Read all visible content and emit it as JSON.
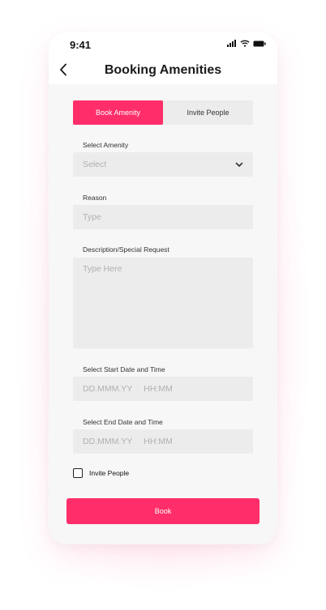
{
  "status_bar": {
    "time": "9:41"
  },
  "header": {
    "title": "Booking Amenities"
  },
  "tabs": [
    {
      "label": "Book Amenity",
      "active": true
    },
    {
      "label": "Invite People",
      "active": false
    }
  ],
  "form": {
    "amenity": {
      "label": "Select Amenity",
      "value": "Select"
    },
    "reason": {
      "label": "Reason",
      "placeholder": "Type"
    },
    "description": {
      "label": "Description/Special Request",
      "placeholder": "Type Here"
    },
    "start": {
      "label": "Select Start Date and Time",
      "date_placeholder": "DD.MMM.YY",
      "time_placeholder": "HH:MM"
    },
    "end": {
      "label": "Select End Date and Time",
      "date_placeholder": "DD.MMM.YY",
      "time_placeholder": "HH:MM"
    },
    "invite_checkbox": {
      "label": "Invite People",
      "checked": false
    }
  },
  "actions": {
    "book_label": "Book"
  },
  "colors": {
    "accent": "#ff2e6a",
    "field_bg": "#ececec",
    "page_bg": "#f7f7f7"
  }
}
